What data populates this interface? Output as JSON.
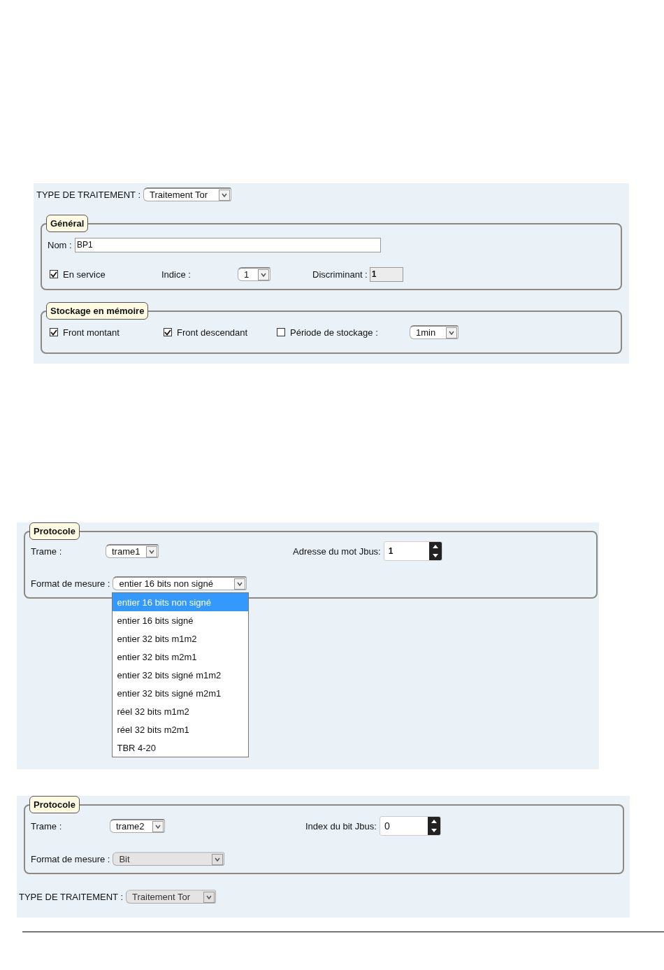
{
  "traitement": {
    "label": "TYPE DE TRAITEMENT :",
    "value": "Traitement Tor",
    "disabled": false
  },
  "general": {
    "legend": "Général",
    "nom": {
      "label": "Nom :",
      "value": "BP1"
    },
    "en_service": {
      "label": "En service",
      "checked": true
    },
    "indice": {
      "label": "Indice :",
      "value": "1"
    },
    "discriminant": {
      "label": "Discriminant :",
      "value": "1"
    }
  },
  "stockage": {
    "legend": "Stockage en mémoire",
    "options": [
      {
        "label": "Front montant",
        "checked": true
      },
      {
        "label": "Front descendant",
        "checked": true
      },
      {
        "label": "Période de stockage :",
        "checked": false
      }
    ],
    "periode": {
      "value": "1min"
    }
  },
  "protocole_1": {
    "legend": "Protocole",
    "trame": {
      "label": "Trame :",
      "value": "trame1"
    },
    "adresse": {
      "label": "Adresse du mot Jbus:",
      "value": "1"
    },
    "format": {
      "label": "Format de mesure :",
      "value": "entier 16 bits non signé",
      "options": [
        {
          "label": "entier 16 bits non signé",
          "selected": true
        },
        {
          "label": "entier 16 bits signé",
          "selected": false
        },
        {
          "label": "entier 32 bits m1m2",
          "selected": false
        },
        {
          "label": "entier 32 bits m2m1",
          "selected": false
        },
        {
          "label": "entier 32 bits signé m1m2",
          "selected": false
        },
        {
          "label": "entier 32 bits signé m2m1",
          "selected": false
        },
        {
          "label": "réel 32 bits m1m2",
          "selected": false
        },
        {
          "label": "réel 32 bits m2m1",
          "selected": false
        },
        {
          "label": "TBR 4-20",
          "selected": false
        }
      ]
    }
  },
  "protocole_2": {
    "legend": "Protocole",
    "trame": {
      "label": "Trame :",
      "value": "trame2"
    },
    "index": {
      "label": "Index du bit Jbus:",
      "value": "0"
    },
    "format": {
      "label": "Format de mesure :",
      "value": "Bit",
      "disabled": true
    },
    "traitement": {
      "label": "TYPE DE TRAITEMENT :",
      "value": "Traitement Tor",
      "disabled": true
    }
  }
}
